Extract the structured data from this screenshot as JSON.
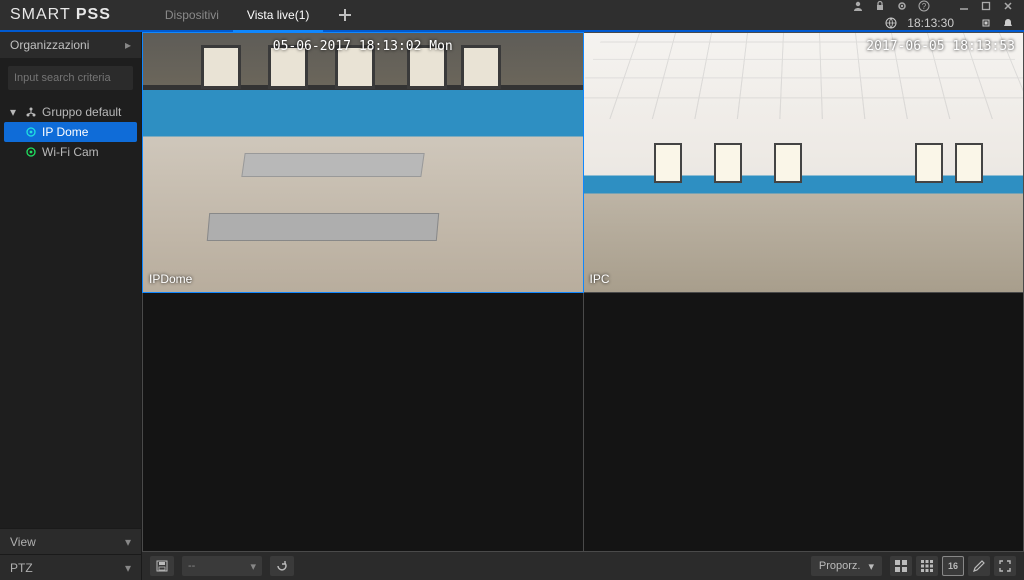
{
  "brand": {
    "thin": "SMART",
    "bold": "PSS"
  },
  "tabs": {
    "dispositivi": "Dispositivi",
    "vistalive": "Vista live(1)"
  },
  "clock": "18:13:30",
  "sidebar": {
    "head": "Organizzazioni",
    "search_placeholder": "Input search criteria",
    "group": "Gruppo default",
    "cam1": "IP Dome",
    "cam2": "Wi-Fi Cam",
    "view": "View",
    "ptz": "PTZ"
  },
  "feeds": {
    "f1": {
      "label": "IPDome",
      "time": "05-06-2017 18:13:02 Mon"
    },
    "f2": {
      "label": "IPC",
      "time": "2017-06-05 18:13:53"
    }
  },
  "bottom": {
    "combo_left": "--",
    "proporz": "Proporz.",
    "layout16": "16"
  }
}
